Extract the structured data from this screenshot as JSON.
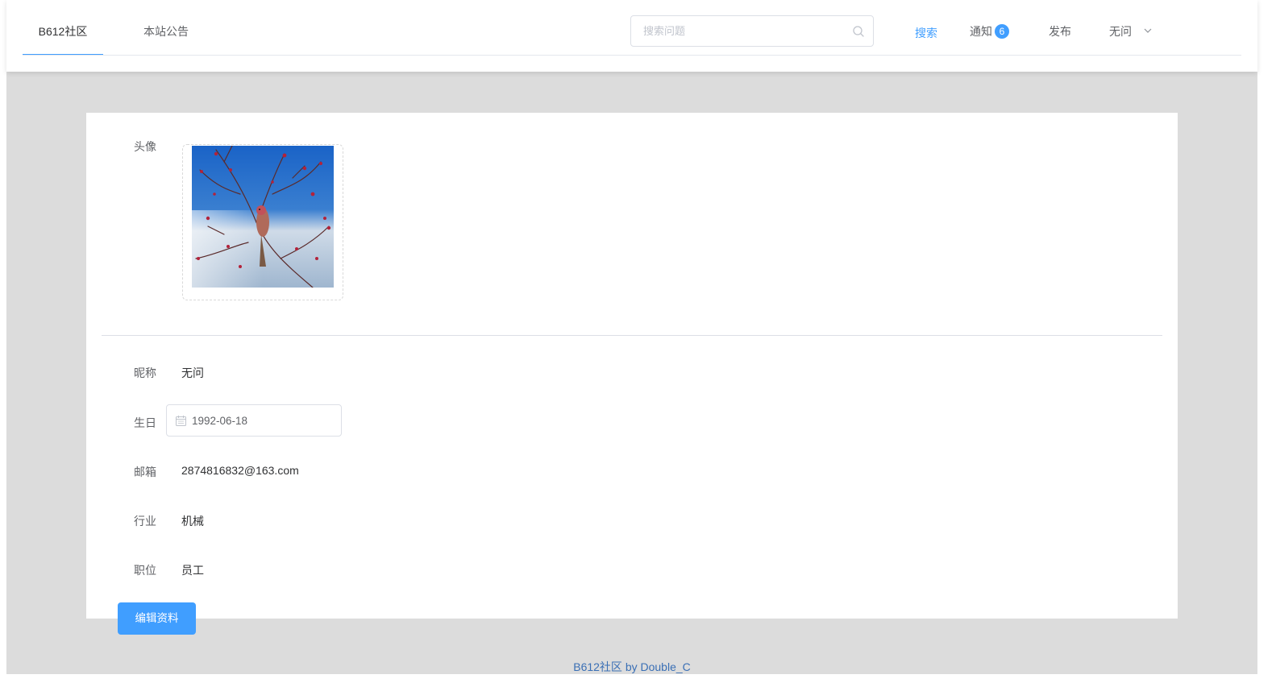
{
  "nav": {
    "tabs": [
      {
        "label": "B612社区",
        "active": true
      },
      {
        "label": "本站公告",
        "active": false
      }
    ]
  },
  "search": {
    "placeholder": "搜索问题",
    "button_label": "搜索"
  },
  "menu": {
    "notify_label": "通知",
    "notify_count": "6",
    "publish_label": "发布",
    "user_label": "无问"
  },
  "profile": {
    "avatar_label": "头像",
    "nickname_label": "昵称",
    "nickname_value": "无问",
    "birthday_label": "生日",
    "birthday_value": "1992-06-18",
    "email_label": "邮箱",
    "email_value": "2874816832@163.com",
    "industry_label": "行业",
    "industry_value": "机械",
    "position_label": "职位",
    "position_value": "员工",
    "edit_button": "编辑资料"
  },
  "footer": {
    "text": "B612社区 by Double_C"
  },
  "colors": {
    "accent": "#409eff",
    "page_bg": "#dcdcdc",
    "footer_text": "#3a6fb5"
  }
}
